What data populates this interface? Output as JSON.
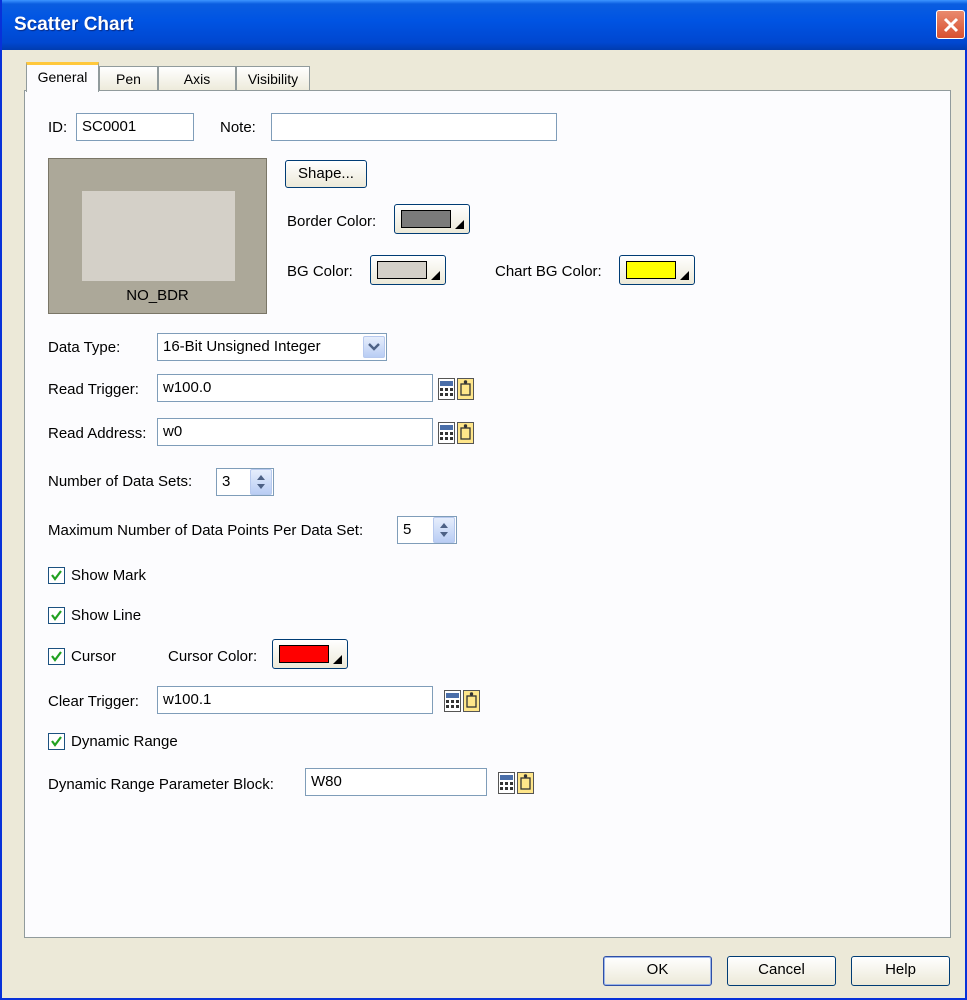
{
  "window": {
    "title": "Scatter Chart"
  },
  "tabs": [
    "General",
    "Pen",
    "Axis",
    "Visibility"
  ],
  "general": {
    "id_label": "ID:",
    "id_value": "SC0001",
    "note_label": "Note:",
    "note_value": "",
    "preview_label": "NO_BDR",
    "shape_button": "Shape...",
    "border_color_label": "Border Color:",
    "bg_color_label": "BG Color:",
    "chart_bg_color_label": "Chart BG Color:",
    "data_type_label": "Data Type:",
    "data_type_value": "16-Bit Unsigned Integer",
    "read_trigger_label": "Read Trigger:",
    "read_trigger_value": "w100.0",
    "read_address_label": "Read Address:",
    "read_address_value": "w0",
    "num_data_sets_label": "Number of Data Sets:",
    "num_data_sets_value": "3",
    "max_points_label": "Maximum Number of Data Points Per Data Set:",
    "max_points_value": "5",
    "show_mark_label": "Show Mark",
    "show_line_label": "Show Line",
    "cursor_label": "Cursor",
    "cursor_color_label": "Cursor Color:",
    "clear_trigger_label": "Clear Trigger:",
    "clear_trigger_value": "w100.1",
    "dynamic_range_label": "Dynamic Range",
    "dynamic_range_block_label": "Dynamic Range Parameter Block:",
    "dynamic_range_block_value": "W80"
  },
  "colors": {
    "border_color": "#7b7b7b",
    "bg_color": "#d4d0c8",
    "chart_bg_color": "#ffff00",
    "cursor_color": "#ff0000"
  },
  "checkboxes": {
    "show_mark": true,
    "show_line": true,
    "cursor": true,
    "dynamic_range": true
  },
  "footer": {
    "ok": "OK",
    "cancel": "Cancel",
    "help": "Help"
  }
}
